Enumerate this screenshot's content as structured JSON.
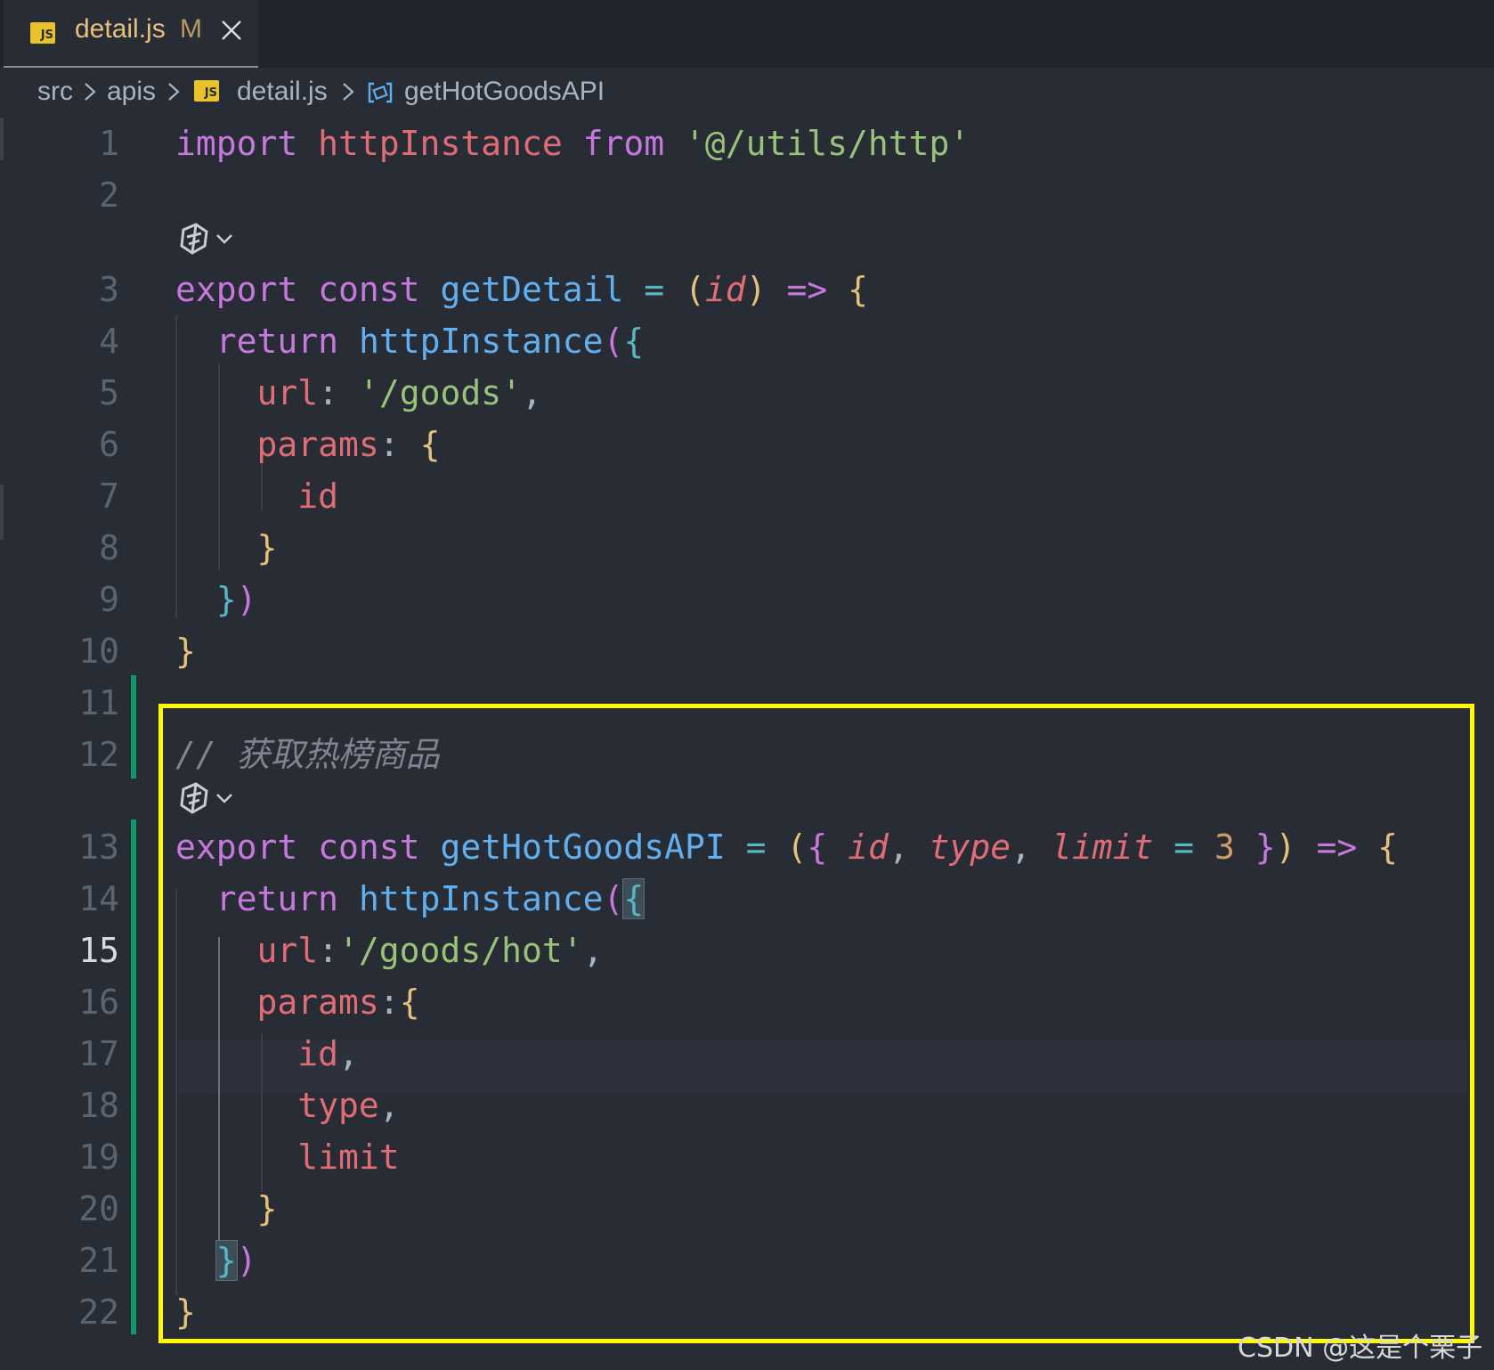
{
  "tab": {
    "icon": "JS",
    "filename": "detail.js",
    "modified_flag": "M"
  },
  "breadcrumb": {
    "items": [
      "src",
      "apis",
      "detail.js",
      "getHotGoodsAPI"
    ]
  },
  "line_numbers": [
    "1",
    "2",
    "3",
    "4",
    "5",
    "6",
    "7",
    "8",
    "9",
    "10",
    "11",
    "12",
    "13",
    "14",
    "15",
    "16",
    "17",
    "18",
    "19",
    "20",
    "21",
    "22"
  ],
  "code": {
    "l1": {
      "import": "import",
      "name": "httpInstance",
      "from": "from",
      "path": "'@/utils/http'"
    },
    "l3": {
      "export": "export",
      "const": "const",
      "fn": "getDetail",
      "eq": "=",
      "lp": "(",
      "param": "id",
      "rp": ")",
      "arrow": "=>",
      "lb": "{"
    },
    "l4": {
      "ret": "return",
      "fn": "httpInstance",
      "lp": "(",
      "lb": "{"
    },
    "l5": {
      "key": "url",
      "colon": ":",
      "val": "'/goods'",
      "comma": ","
    },
    "l6": {
      "key": "params",
      "colon": ":",
      "lb": "{"
    },
    "l7": {
      "val": "id"
    },
    "l8": {
      "rb": "}"
    },
    "l9": {
      "rb": "}",
      "rp": ")"
    },
    "l10": {
      "rb": "}"
    },
    "l12": {
      "comment": "// 获取热榜商品"
    },
    "l13": {
      "export": "export",
      "const": "const",
      "fn": "getHotGoodsAPI",
      "eq": "=",
      "lp": "(",
      "lb": "{",
      "p1": "id",
      "c1": ",",
      "p2": "type",
      "c2": ",",
      "p3": "limit",
      "eq2": "=",
      "num": "3",
      "rb": "}",
      "rp": ")",
      "arrow": "=>",
      "lb2": "{"
    },
    "l14": {
      "ret": "return",
      "fn": "httpInstance",
      "lp": "(",
      "lb": "{"
    },
    "l15": {
      "key": "url",
      "colon": ":",
      "val": "'/goods/hot'",
      "comma": ","
    },
    "l16": {
      "key": "params",
      "colon": ":",
      "lb": "{"
    },
    "l17": {
      "val": "id",
      "comma": ","
    },
    "l18": {
      "val": "type",
      "comma": ","
    },
    "l19": {
      "val": "limit"
    },
    "l20": {
      "rb": "}"
    },
    "l21": {
      "rb": "}",
      "rp": ")"
    },
    "l22": {
      "rb": "}"
    }
  },
  "colors": {
    "background": "#282c34",
    "highlight_box": "#fffb00",
    "git_added": "#109868"
  },
  "watermark": "CSDN @这是个栗子"
}
